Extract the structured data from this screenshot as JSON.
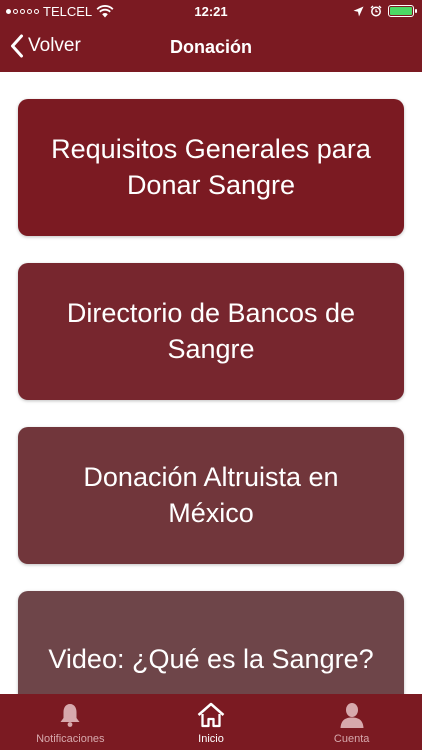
{
  "status_bar": {
    "carrier": "TELCEL",
    "time": "12:21"
  },
  "nav": {
    "back_label": "Volver",
    "title": "Donación"
  },
  "cards": [
    {
      "label": "Requisitos Generales para Donar Sangre"
    },
    {
      "label": "Directorio de Bancos de Sangre"
    },
    {
      "label": "Donación Altruista en México"
    },
    {
      "label": "Video: ¿Qué es la Sangre?"
    }
  ],
  "tabbar": {
    "items": [
      {
        "label": "Notificaciones",
        "icon": "bell-icon",
        "active": false
      },
      {
        "label": "Inicio",
        "icon": "home-icon",
        "active": true
      },
      {
        "label": "Cuenta",
        "icon": "user-icon",
        "active": false
      }
    ]
  },
  "colors": {
    "brand": "#7b1a22",
    "battery": "#4cd964"
  }
}
